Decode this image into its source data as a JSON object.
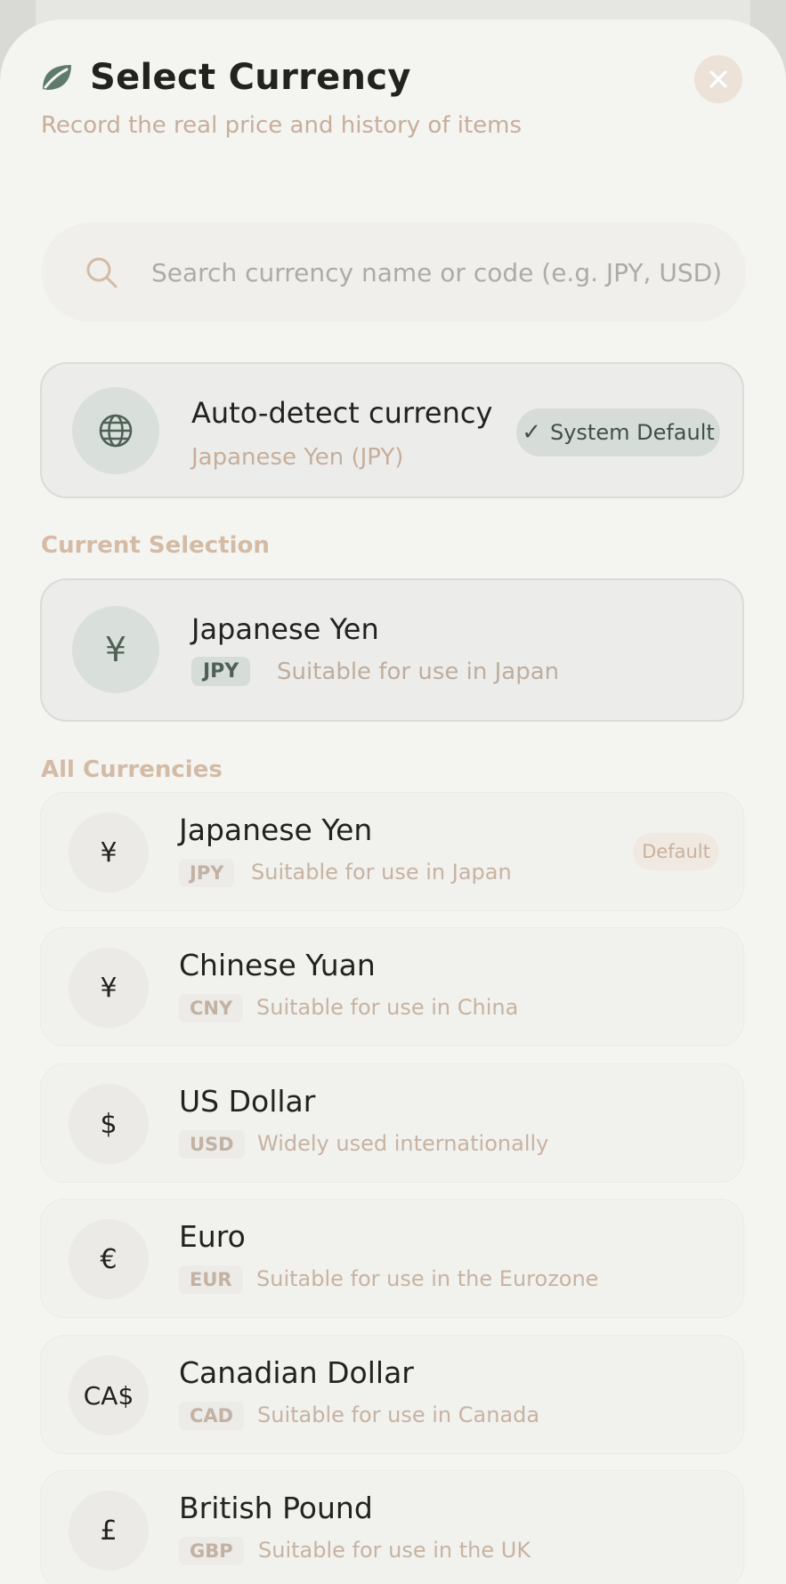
{
  "header": {
    "title": "Select Currency",
    "subtitle": "Record the real price and history of items",
    "leaf_icon": "leaf-icon",
    "close_icon": "close-icon"
  },
  "search": {
    "placeholder": "Search currency name or code (e.g. JPY, USD)",
    "value": ""
  },
  "auto_detect": {
    "title": "Auto-detect currency",
    "detected": "Japanese Yen (JPY)",
    "badge": "System Default",
    "badge_check": "✓",
    "icon": "globe-icon"
  },
  "current_selection": {
    "label": "Current Selection",
    "symbol": "¥",
    "name": "Japanese Yen",
    "code": "JPY",
    "description": "Suitable for use in Japan"
  },
  "all_currencies": {
    "label": "All Currencies",
    "items": [
      {
        "symbol": "¥",
        "name": "Japanese Yen",
        "code": "JPY",
        "description": "Suitable for use in Japan",
        "badge": "Default"
      },
      {
        "symbol": "¥",
        "name": "Chinese Yuan",
        "code": "CNY",
        "description": "Suitable for use in China"
      },
      {
        "symbol": "$",
        "name": "US Dollar",
        "code": "USD",
        "description": "Widely used internationally"
      },
      {
        "symbol": "€",
        "name": "Euro",
        "code": "EUR",
        "description": "Suitable for use in the Eurozone"
      },
      {
        "symbol": "CA$",
        "name": "Canadian Dollar",
        "code": "CAD",
        "description": "Suitable for use in Canada"
      },
      {
        "symbol": "£",
        "name": "British Pound",
        "code": "GBP",
        "description": "Suitable for use in the UK"
      }
    ]
  },
  "colors": {
    "accent": "#5e7a6b",
    "sheet_bg": "#f4f4f1",
    "muted_text": "#c7ae9b"
  }
}
